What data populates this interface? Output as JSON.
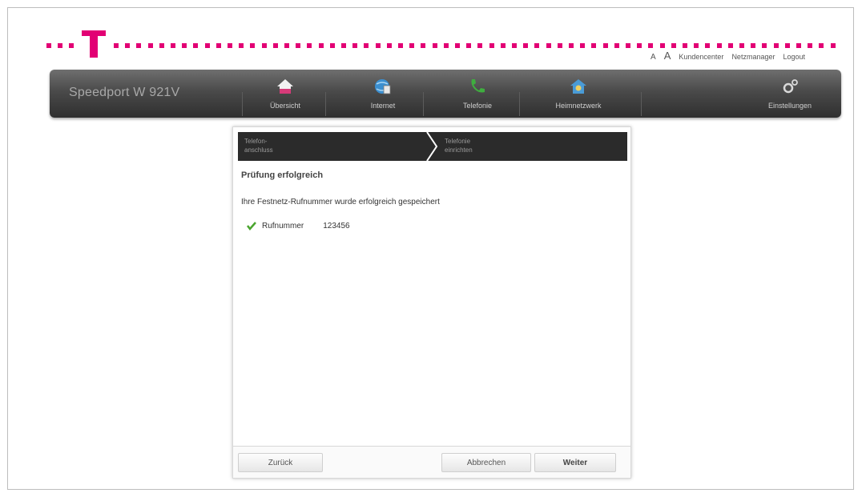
{
  "brand": {
    "logo_icon": "telekom-t-logo",
    "accent_color": "#e20074"
  },
  "top_links": {
    "font_small": "A",
    "font_large": "A",
    "customer_center": "Kundencenter",
    "network_manager": "Netzmanager",
    "logout": "Logout"
  },
  "navbar": {
    "product": "Speedport W 921V",
    "items": [
      {
        "label": "Übersicht",
        "icon": "home-icon"
      },
      {
        "label": "Internet",
        "icon": "internet-globe-icon"
      },
      {
        "label": "Telefonie",
        "icon": "phone-icon"
      },
      {
        "label": "Heimnetzwerk",
        "icon": "home-network-icon"
      },
      {
        "label": "Einstellungen",
        "icon": "settings-gear-icon"
      }
    ]
  },
  "wizard": {
    "steps": [
      {
        "line1": "Telefon-",
        "line2": "anschluss"
      },
      {
        "line1": "Telefonie",
        "line2": "einrichten"
      }
    ],
    "title": "Prüfung erfolgreich",
    "message": "Ihre Festnetz-Rufnummer wurde erfolgreich gespeichert",
    "number_label": "Rufnummer",
    "number_value": "123456",
    "buttons": {
      "back": "Zurück",
      "cancel": "Abbrechen",
      "next": "Weiter"
    }
  }
}
